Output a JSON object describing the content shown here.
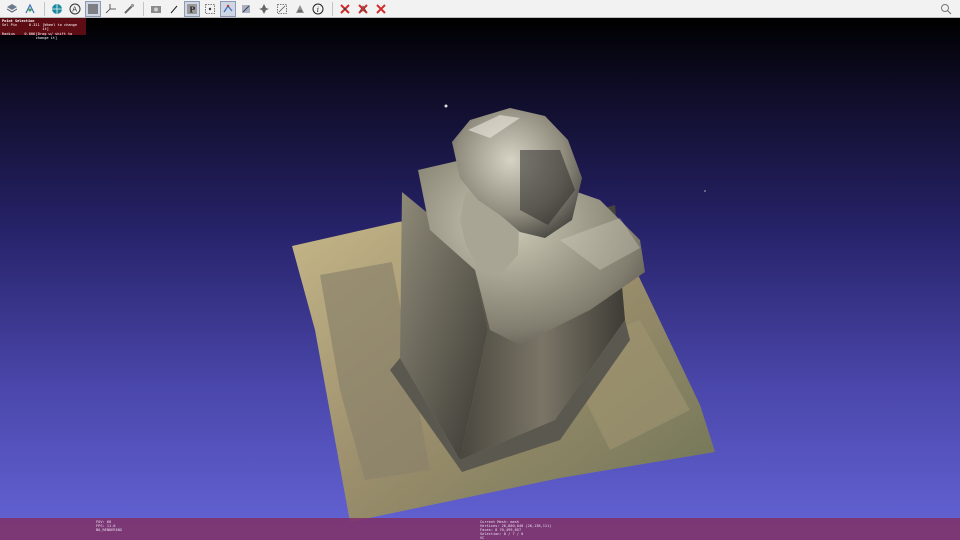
{
  "toolbar": {
    "icons": [
      {
        "name": "layers-icon"
      },
      {
        "name": "align-icon"
      },
      {
        "name": "globe-icon"
      },
      {
        "name": "annotation-icon"
      },
      {
        "name": "render-mode-icon"
      },
      {
        "name": "axis-icon"
      },
      {
        "name": "measure-icon"
      },
      {
        "name": "camera-icon"
      },
      {
        "name": "picking-icon"
      },
      {
        "name": "paint-icon"
      },
      {
        "name": "select-points-icon"
      },
      {
        "name": "select-vertices-icon"
      },
      {
        "name": "move-icon"
      },
      {
        "name": "select-faces-icon"
      },
      {
        "name": "connected-select-icon"
      },
      {
        "name": "zscan-icon"
      },
      {
        "name": "info-icon"
      }
    ],
    "delete_icons": [
      "delete-vertices-icon",
      "delete-faces-icon",
      "delete-all-icon"
    ],
    "search_icon": "search-icon",
    "accent": "#d42a2a"
  },
  "info_panel": {
    "title": "Point Selection",
    "rows": [
      {
        "key": "Sel Pin",
        "value": "0.311",
        "hint": "[Wheel to change it]"
      },
      {
        "key": "Radius",
        "value": "0.006",
        "hint": "[Drag w/ shift to change it]"
      }
    ]
  },
  "status": {
    "left": [
      "FOV: 60",
      "FPS: 11.0",
      "BO_RENDERING"
    ],
    "center": [
      "Current Mesh: mesh",
      "Vertices: 26,800,040   (26,138,111)",
      "Faces: 8   70,499,857",
      "Selection: 0 / 7 / 0",
      "VC"
    ]
  },
  "colors": {
    "selection_box": "#6e0e16",
    "status_bar": "#7e346c",
    "sky_top": "#000000",
    "sky_bottom": "#6464d6"
  }
}
